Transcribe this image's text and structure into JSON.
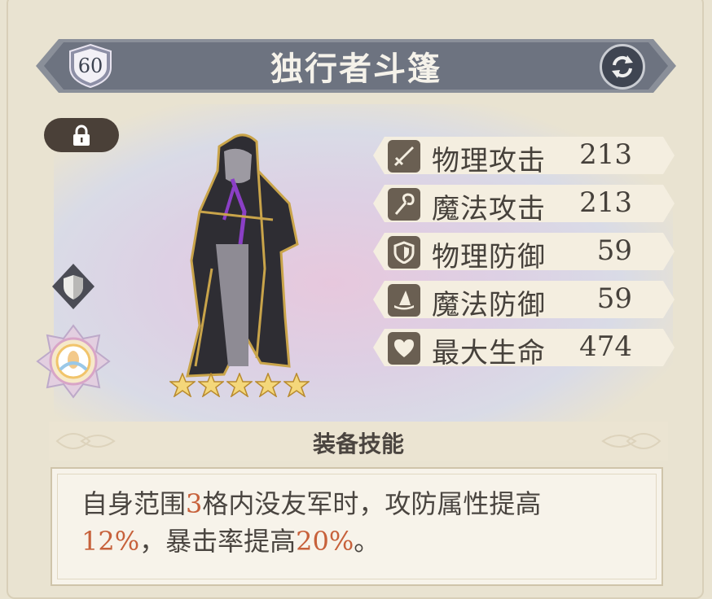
{
  "item": {
    "level": "60",
    "name": "独行者斗篷",
    "stars": 5
  },
  "stats": [
    {
      "icon": "sword-icon",
      "label": "物理攻击",
      "value": "213"
    },
    {
      "icon": "staff-icon",
      "label": "魔法攻击",
      "value": "213"
    },
    {
      "icon": "shield-icon",
      "label": "物理防御",
      "value": "59"
    },
    {
      "icon": "wizard-hat-icon",
      "label": "魔法防御",
      "value": "59"
    },
    {
      "icon": "heart-icon",
      "label": "最大生命",
      "value": "474"
    }
  ],
  "skill": {
    "header": "装备技能",
    "desc_parts": [
      "自身范围",
      "3",
      "格内没友军时，攻防属性提高",
      "12%",
      "，暴击率提高",
      "20%",
      "。"
    ]
  },
  "colors": {
    "title_bar": "#6d7380",
    "highlight": "#c7613b",
    "stat_pill": "#f4eee0",
    "icon_bg": "#6a5f52"
  }
}
